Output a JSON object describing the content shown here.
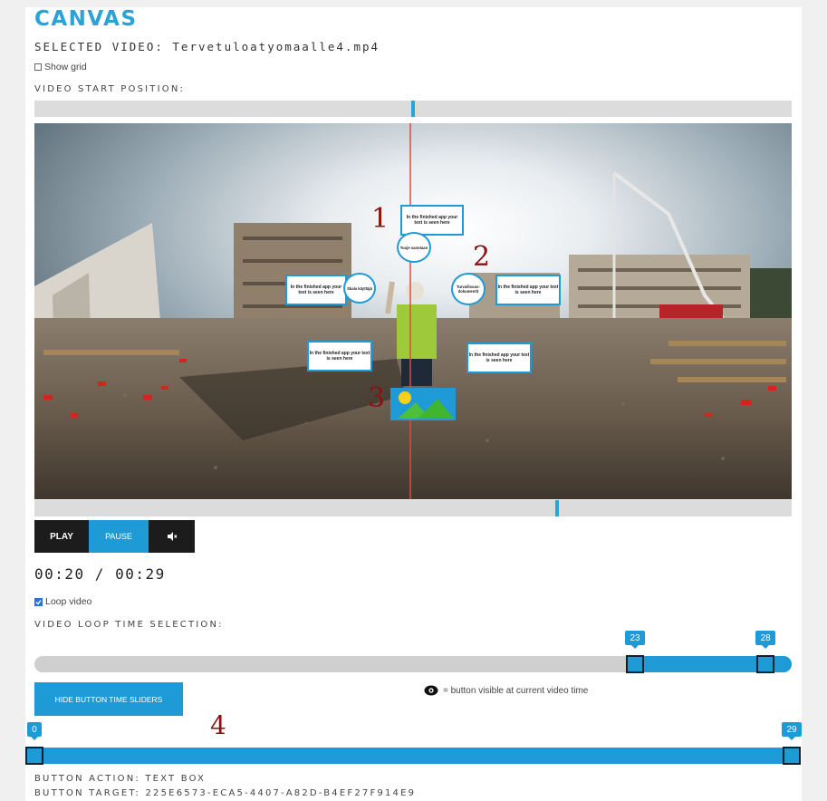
{
  "header": {
    "title": "CANVAS",
    "selected_video_label": "SELECTED VIDEO: Tervetuloatyomaalle4.mp4"
  },
  "show_grid": {
    "label": "Show grid",
    "checked": false
  },
  "start_position": {
    "label": "VIDEO START POSITION:",
    "value_fraction": 0.5
  },
  "video_overlay": {
    "textbox_text": "In the finished app your text is seen here",
    "circles": [
      "Tuuje sanotaan",
      "Skala käyttäjä",
      "Turvallisuus-dokumentit"
    ],
    "markers": [
      "1",
      "2",
      "3",
      "4"
    ]
  },
  "playback_position_fraction": 0.69,
  "controls": {
    "play_label": "PLAY",
    "pause_label": "PAUSE",
    "mute_icon": "speaker-mute-icon",
    "time_display": "00:20 / 00:29"
  },
  "loop": {
    "label": "Loop video",
    "checked": true,
    "selection_label": "VIDEO LOOP TIME SELECTION:",
    "start": "23",
    "end": "28",
    "duration": 29
  },
  "hide_sliders_button": "HIDE BUTTON TIME SLIDERS",
  "legend": {
    "icon": "eye-icon",
    "text": "= button visible at current video time"
  },
  "button_slider": {
    "start": "0",
    "end": "29",
    "duration": 29
  },
  "button_info": {
    "action": "BUTTON ACTION: TEXT BOX",
    "target": "BUTTON TARGET: 225E6573-ECA5-4407-A82D-B4EF27F914E9"
  },
  "colors": {
    "accent": "#1e9bd7",
    "title": "#2aa3d9",
    "dark": "#1c1c1c",
    "marker": "#8a1212"
  }
}
